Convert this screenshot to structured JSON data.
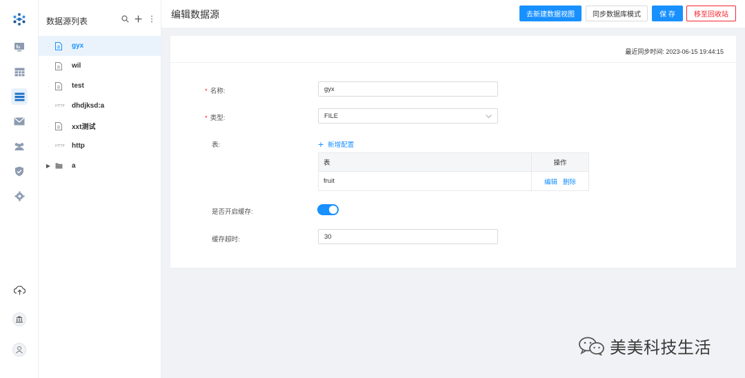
{
  "rail": {
    "icons": [
      "logo-icon",
      "monitor-icon",
      "table-icon",
      "list-icon",
      "mail-icon",
      "users-icon",
      "shield-icon",
      "gear-icon",
      "cloud-upload-icon",
      "bank-icon",
      "user-icon"
    ]
  },
  "tree": {
    "title": "数据源列表",
    "items": [
      {
        "label": "gyx",
        "type": "file",
        "selected": true
      },
      {
        "label": "wil",
        "type": "file"
      },
      {
        "label": "test",
        "type": "file"
      },
      {
        "label": "dhdjksd:a",
        "type": "http",
        "tag": "HTTP"
      },
      {
        "label": "xxt测试",
        "type": "file"
      },
      {
        "label": "http",
        "type": "http",
        "tag": "HTTP"
      },
      {
        "label": "a",
        "type": "folder"
      }
    ]
  },
  "header": {
    "title": "编辑数据源",
    "buttons": {
      "new_view": "去新建数据视图",
      "sync_schema": "同步数据库模式",
      "save": "保 存",
      "recycle": "移至回收站"
    }
  },
  "form": {
    "sync_time": "最近同步时间: 2023-06-15 19:44:15",
    "name_label": "名称:",
    "name_value": "gyx",
    "type_label": "类型:",
    "type_value": "FILE",
    "table_label": "表:",
    "add_config": "新增配置",
    "table": {
      "headers": [
        "表",
        "操作"
      ],
      "rows": [
        {
          "name": "fruit",
          "edit": "编辑",
          "delete": "删除"
        }
      ]
    },
    "cache_label": "是否开启缓存:",
    "cache_enabled": true,
    "timeout_label": "缓存超时:",
    "timeout_value": "30"
  },
  "watermark": {
    "text": "美美科技生活"
  },
  "colors": {
    "primary": "#1890ff",
    "danger": "#f5222d",
    "background": "#f0f2f5"
  }
}
